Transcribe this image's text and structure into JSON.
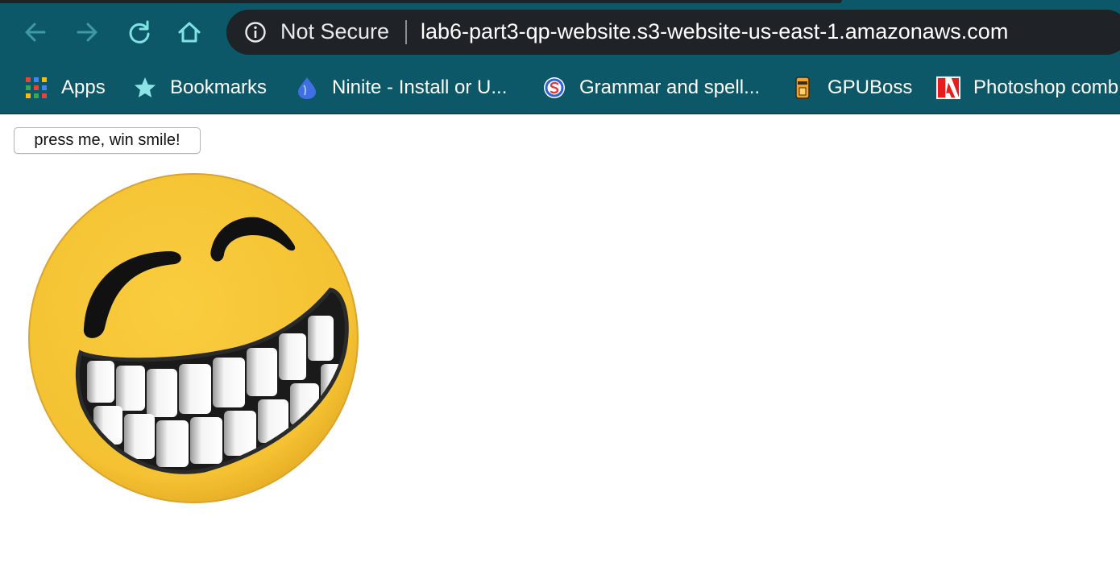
{
  "browser": {
    "security_label": "Not Secure",
    "url": "lab6-part3-qp-website.s3-website-us-east-1.amazonaws.com",
    "nav_icons": [
      "back-arrow-icon",
      "forward-arrow-icon",
      "reload-icon",
      "home-icon"
    ]
  },
  "bookmarks": [
    {
      "label": "Apps",
      "icon": "apps-grid-icon"
    },
    {
      "label": "Bookmarks",
      "icon": "star-icon"
    },
    {
      "label": "Ninite - Install or U...",
      "icon": "ninite-icon"
    },
    {
      "label": "Grammar and spell...",
      "icon": "grammar-icon"
    },
    {
      "label": "GPUBoss",
      "icon": "gpuboss-icon"
    },
    {
      "label": "Photoshop comb",
      "icon": "adobe-icon"
    }
  ],
  "page": {
    "button_label": "press me, win smile!",
    "image": "laughing-smiley-face"
  },
  "colors": {
    "toolbar": "#0c5868",
    "omnibox": "#1f2226",
    "accent_teal": "#7fe3e3",
    "smiley_yellow": "#f6c436"
  }
}
